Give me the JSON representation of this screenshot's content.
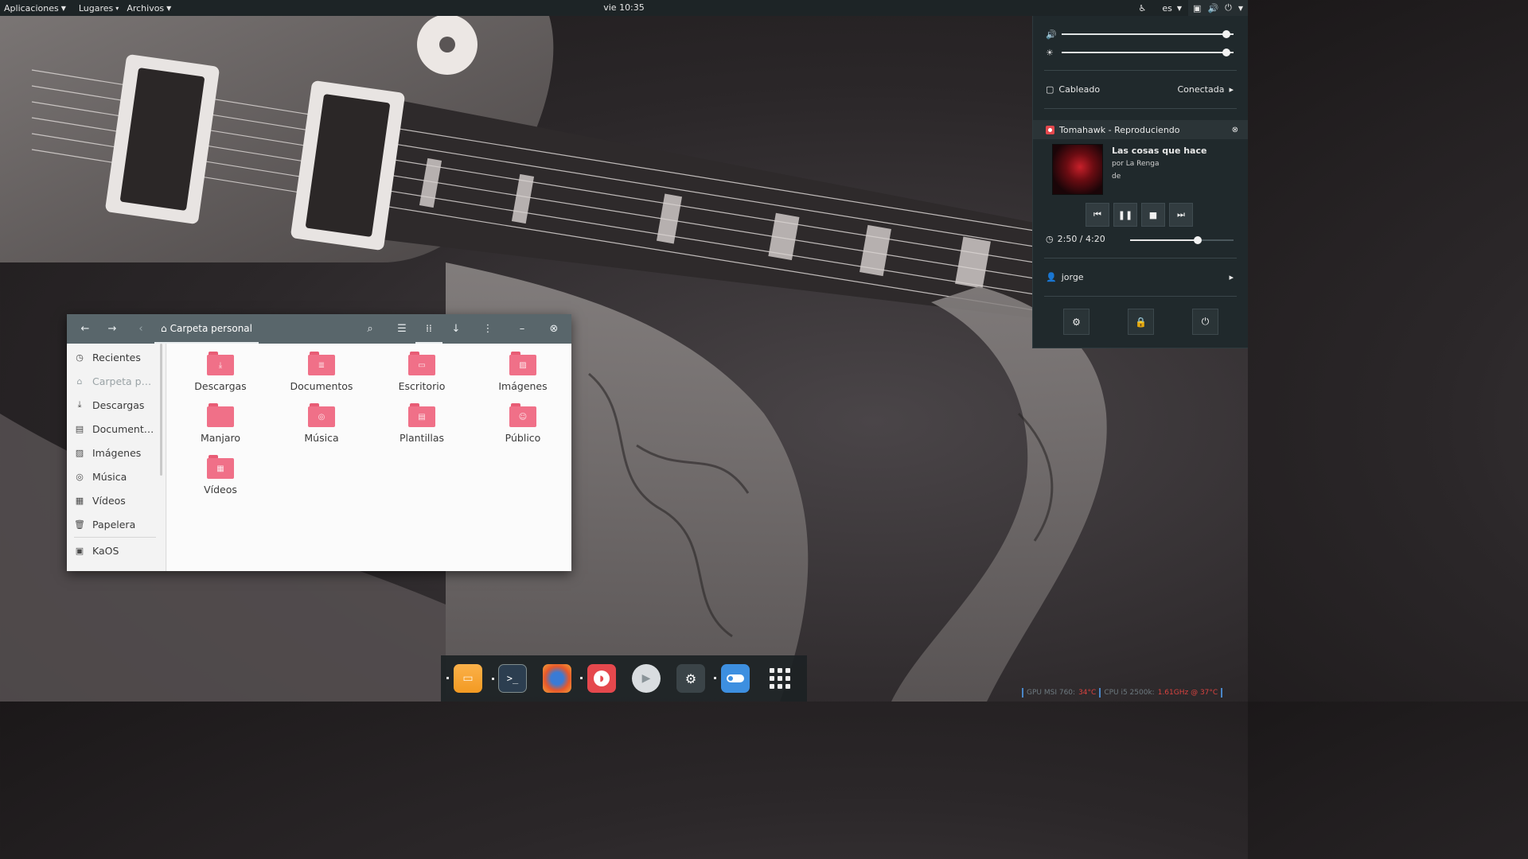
{
  "topbar": {
    "applications": "Aplicaciones",
    "places": "Lugares",
    "files": "Archivos",
    "clock": "vie 10:35",
    "keyboard_layout": "es",
    "icons": [
      "accessibility-icon",
      "network-icon",
      "volume-icon",
      "power-icon"
    ]
  },
  "system_menu": {
    "volume_level": 0.96,
    "brightness_level": 0.96,
    "network": {
      "label": "Cableado",
      "status": "Conectada"
    },
    "player": {
      "header": "Tomahawk - Reproduciendo",
      "title": "Las cosas que hace",
      "artist": "por La Renga",
      "album": "de",
      "time": "2:50 / 4:20",
      "progress": 0.654
    },
    "user": {
      "name": "jorge"
    },
    "buttons": [
      "settings-icon",
      "lock-icon",
      "power-icon"
    ]
  },
  "file_manager": {
    "title": "Carpeta personal",
    "sidebar": [
      {
        "label": "Recientes",
        "icon": "clock-icon"
      },
      {
        "label": "Carpeta p…",
        "icon": "home-icon"
      },
      {
        "label": "Descargas",
        "icon": "download-icon"
      },
      {
        "label": "Document…",
        "icon": "document-icon"
      },
      {
        "label": "Imágenes",
        "icon": "image-icon"
      },
      {
        "label": "Música",
        "icon": "music-icon"
      },
      {
        "label": "Vídeos",
        "icon": "video-icon"
      },
      {
        "label": "Papelera",
        "icon": "trash-icon"
      },
      {
        "label": "KaOS",
        "icon": "drive-icon"
      }
    ],
    "folders": [
      {
        "label": "Descargas",
        "glyph": "⤓"
      },
      {
        "label": "Documentos",
        "glyph": "≣"
      },
      {
        "label": "Escritorio",
        "glyph": "▭"
      },
      {
        "label": "Imágenes",
        "glyph": "▨"
      },
      {
        "label": "Manjaro",
        "glyph": ""
      },
      {
        "label": "Música",
        "glyph": "◎"
      },
      {
        "label": "Plantillas",
        "glyph": "▤"
      },
      {
        "label": "Público",
        "glyph": "☺"
      },
      {
        "label": "Vídeos",
        "glyph": "▦"
      }
    ],
    "accent": "#f07088"
  },
  "dock": {
    "apps": [
      "files-app",
      "terminal-app",
      "firefox-app",
      "tomahawk-app",
      "media-player-app",
      "steam-app",
      "toggle-app",
      "show-apps-grid"
    ]
  },
  "conky": {
    "gpu_label": "GPU MSI 760:",
    "gpu_temp": "34°C",
    "cpu_label": "CPU i5 2500k:",
    "cpu_value": "1.61GHz @ 37°C"
  }
}
